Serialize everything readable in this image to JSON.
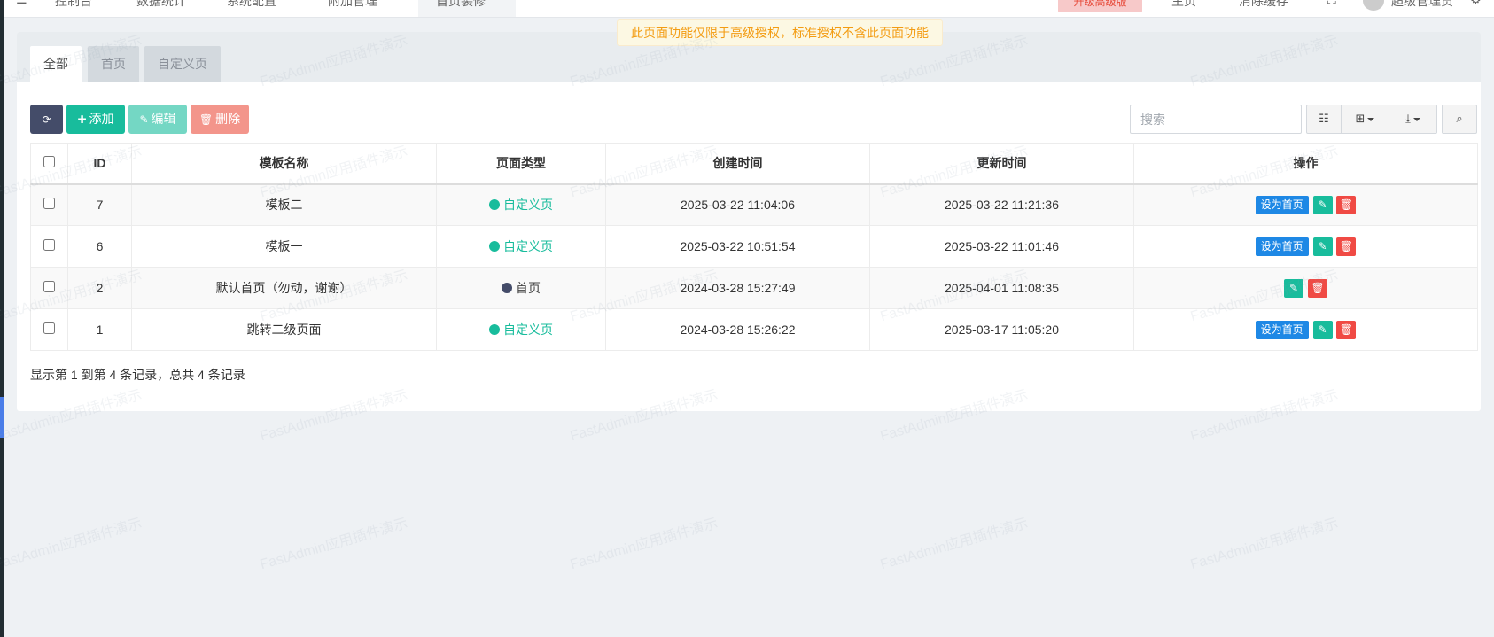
{
  "topbar": {
    "items": [
      "控制台",
      "数据统计",
      "系统配置",
      "附加管理",
      "首页装修"
    ],
    "upgrade_label": "升级高级版",
    "right_items": [
      "主页",
      "清除缓存",
      "超级管理员"
    ]
  },
  "notice": "此页面功能仅限于高级授权，标准授权不含此页面功能",
  "tabs": [
    {
      "label": "全部",
      "active": true
    },
    {
      "label": "首页",
      "active": false
    },
    {
      "label": "自定义页",
      "active": false
    }
  ],
  "toolbar": {
    "add_label": "添加",
    "edit_label": "编辑",
    "delete_label": "删除",
    "search_placeholder": "搜索"
  },
  "table": {
    "columns": [
      "ID",
      "模板名称",
      "页面类型",
      "创建时间",
      "更新时间",
      "操作"
    ],
    "rows": [
      {
        "id": "7",
        "name": "模板二",
        "type": "自定义页",
        "created": "2025-03-22 11:04:06",
        "updated": "2025-03-22 11:21:36",
        "set_home": "设为首页"
      },
      {
        "id": "6",
        "name": "模板一",
        "type": "自定义页",
        "created": "2025-03-22 10:51:54",
        "updated": "2025-03-22 11:01:46",
        "set_home": "设为首页"
      },
      {
        "id": "2",
        "name": "默认首页（勿动，谢谢）",
        "type": "首页",
        "created": "2024-03-28 15:27:49",
        "updated": "2025-04-01 11:08:35",
        "set_home": ""
      },
      {
        "id": "1",
        "name": "跳转二级页面",
        "type": "自定义页",
        "created": "2024-03-28 15:26:22",
        "updated": "2025-03-17 11:05:20",
        "set_home": "设为首页"
      }
    ]
  },
  "pagination_info": "显示第 1 到第 4 条记录，总共 4 条记录",
  "watermark": "FastAdmin应用插件演示",
  "colors": {
    "custom_type": "#18bc9c",
    "home_type": "#444c69",
    "set_home": "#1e88e5",
    "edit": "#18bc9c",
    "delete": "#f04a44"
  }
}
